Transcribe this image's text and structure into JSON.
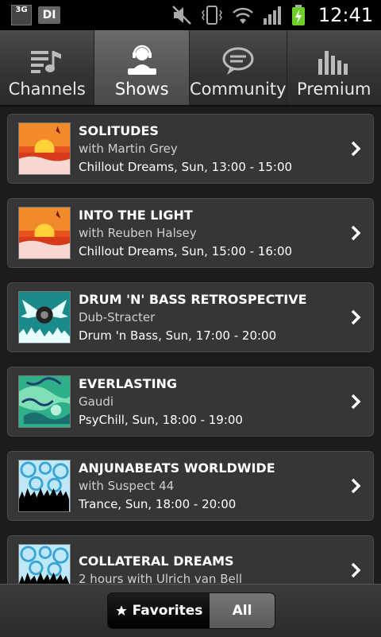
{
  "status_bar": {
    "network_label": "3G",
    "app_badge": "DI",
    "time": "12:41"
  },
  "tabs": [
    {
      "label": "Channels",
      "icon": "channels-icon",
      "active": false
    },
    {
      "label": "Shows",
      "icon": "dj-icon",
      "active": true
    },
    {
      "label": "Community",
      "icon": "chat-bubble-icon",
      "active": false
    },
    {
      "label": "Premium",
      "icon": "equalizer-icon",
      "active": false
    }
  ],
  "shows": [
    {
      "title": "SOLITUDES",
      "host": "with Martin Grey",
      "schedule": "Chillout Dreams, Sun, 13:00 - 15:00",
      "art": "sunset-art"
    },
    {
      "title": "INTO THE LIGHT",
      "host": "with Reuben Halsey",
      "schedule": "Chillout Dreams, Sun, 15:00 - 16:00",
      "art": "sunset-art"
    },
    {
      "title": "DRUM 'N' BASS RETROSPECTIVE",
      "host": "Dub-Stracter",
      "schedule": "Drum 'n Bass, Sun, 17:00 - 20:00",
      "art": "speaker-wings-art"
    },
    {
      "title": "EVERLASTING",
      "host": "Gaudi",
      "schedule": "PsyChill, Sun, 18:00 - 19:00",
      "art": "psychill-art"
    },
    {
      "title": "ANJUNABEATS WORLDWIDE",
      "host": "with Suspect 44",
      "schedule": "Trance, Sun, 18:00 - 20:00",
      "art": "crowd-art"
    },
    {
      "title": "COLLATERAL DREAMS",
      "host": "2 hours with Ulrich van Bell",
      "schedule": "",
      "art": "crowd-art"
    }
  ],
  "filter": {
    "favorites_label": "Favorites",
    "all_label": "All",
    "selected": "Favorites"
  }
}
